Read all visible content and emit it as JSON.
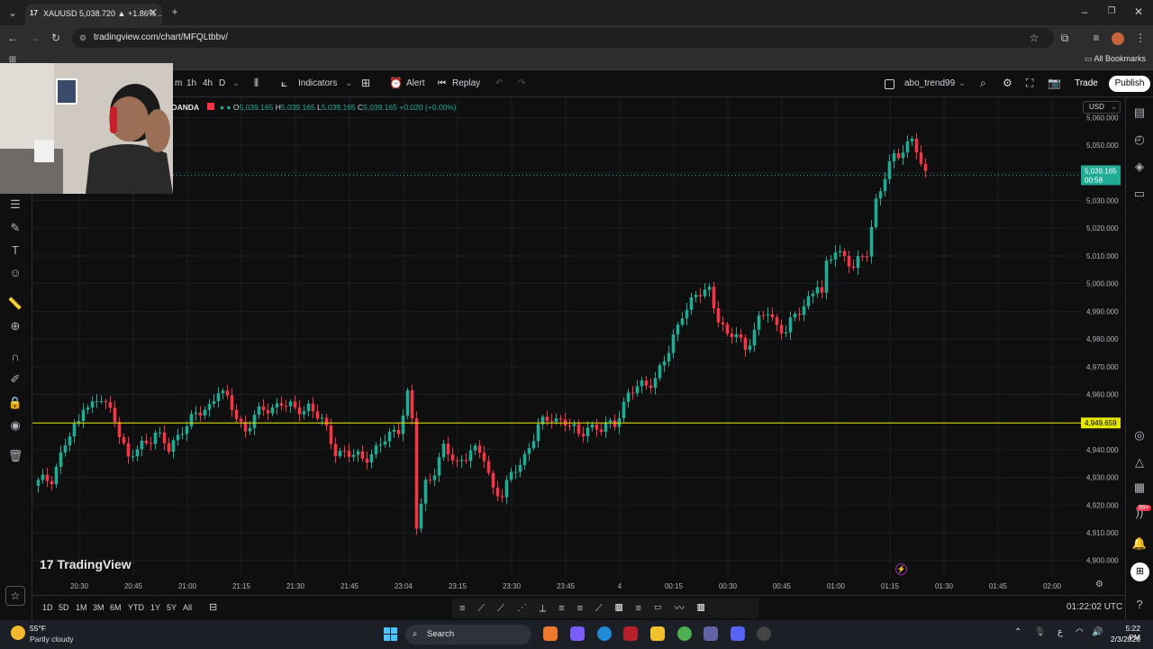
{
  "browser": {
    "tab_title": "XAUUSD 5,038.720 ▲ +1.86% ...",
    "url": "tradingview.com/chart/MFQLtbbv/",
    "bookmarks_label": "All Bookmarks"
  },
  "toolbar": {
    "intervals": [
      "m",
      "1h",
      "4h",
      "D"
    ],
    "indicators_label": "Indicators",
    "alert_label": "Alert",
    "replay_label": "Replay",
    "layout_name": "abo_trend99",
    "trade_label": "Trade",
    "publish_label": "Publish"
  },
  "legend": {
    "symbol": "OANDA",
    "open_label": "O",
    "open": "5,039.165",
    "high_label": "H",
    "high": "5,039.165",
    "low_label": "L",
    "low": "5,039.165",
    "close_label": "C",
    "close": "5,039.165",
    "change": "+0.020 (+0.00%)"
  },
  "currency": "USD",
  "watermark": "TradingView",
  "current_price": {
    "value": "5,039.165",
    "countdown": "00:58"
  },
  "horizontal_line": {
    "value": "4,949.659",
    "price": 4949.659,
    "color": "#e6e600"
  },
  "colors": {
    "up": "#22ab94",
    "down": "#f23645",
    "accent": "#2962ff"
  },
  "range_buttons": [
    "1D",
    "5D",
    "1M",
    "3M",
    "6M",
    "YTD",
    "1Y",
    "5Y",
    "All"
  ],
  "clock": "01:22:02 UTC",
  "taskbar": {
    "weather_temp": "55°F",
    "weather_desc": "Partly cloudy",
    "search_label": "Search",
    "time": "5:22 PM",
    "date": "2/3/2026",
    "notification_badge": "99+"
  },
  "chart_data": {
    "type": "candlestick",
    "symbol": "XAUUSD",
    "price_ticks": [
      "5,060.000",
      "5,050.000",
      "5,040.000",
      "5,030.000",
      "5,020.000",
      "5,010.000",
      "5,000.000",
      "4,990.000",
      "4,980.000",
      "4,970.000",
      "4,960.000",
      "4,950.000",
      "4,940.000",
      "4,930.000",
      "4,920.000",
      "4,910.000",
      "4,900.000"
    ],
    "price_tick_values": [
      5060,
      5050,
      5040,
      5030,
      5020,
      5010,
      5000,
      4990,
      4980,
      4970,
      4960,
      4950,
      4940,
      4930,
      4920,
      4910,
      4900
    ],
    "time_ticks": [
      "20:30",
      "20:45",
      "21:00",
      "21:15",
      "21:30",
      "21:45",
      "23:04",
      "23:15",
      "23:30",
      "23:45",
      "4",
      "00:15",
      "00:30",
      "00:45",
      "01:00",
      "01:15",
      "01:30",
      "01:45",
      "02:00"
    ],
    "ylim": [
      4896,
      5066
    ],
    "waypoints": [
      [
        0,
        4928
      ],
      [
        3,
        4930
      ],
      [
        6,
        4942
      ],
      [
        9,
        4950
      ],
      [
        10,
        4957
      ],
      [
        12,
        4956
      ],
      [
        14,
        4958
      ],
      [
        17,
        4952
      ],
      [
        20,
        4936
      ],
      [
        23,
        4942
      ],
      [
        26,
        4946
      ],
      [
        29,
        4940
      ],
      [
        32,
        4948
      ],
      [
        35,
        4952
      ],
      [
        38,
        4956
      ],
      [
        40,
        4962
      ],
      [
        43,
        4955
      ],
      [
        46,
        4947
      ],
      [
        48,
        4952
      ],
      [
        51,
        4955
      ],
      [
        54,
        4957
      ],
      [
        57,
        4954
      ],
      [
        60,
        4956
      ],
      [
        63,
        4950
      ],
      [
        66,
        4940
      ],
      [
        69,
        4938
      ],
      [
        72,
        4937
      ],
      [
        75,
        4940
      ],
      [
        78,
        4945
      ],
      [
        80,
        4948
      ],
      [
        82,
        4960
      ],
      [
        83,
        4950
      ],
      [
        84,
        4912
      ],
      [
        86,
        4928
      ],
      [
        88,
        4933
      ],
      [
        90,
        4940
      ],
      [
        93,
        4935
      ],
      [
        96,
        4940
      ],
      [
        99,
        4937
      ],
      [
        101,
        4926
      ],
      [
        103,
        4924
      ],
      [
        106,
        4933
      ],
      [
        108,
        4938
      ],
      [
        111,
        4948
      ],
      [
        114,
        4952
      ],
      [
        117,
        4950
      ],
      [
        120,
        4945
      ],
      [
        122,
        4949
      ],
      [
        125,
        4947
      ],
      [
        128,
        4950
      ],
      [
        131,
        4960
      ],
      [
        134,
        4963
      ],
      [
        137,
        4966
      ],
      [
        140,
        4975
      ],
      [
        143,
        4990
      ],
      [
        146,
        4995
      ],
      [
        149,
        4998
      ],
      [
        151,
        4988
      ],
      [
        153,
        4980
      ],
      [
        155,
        4982
      ],
      [
        157,
        4977
      ],
      [
        160,
        4986
      ],
      [
        162,
        4990
      ],
      [
        164,
        4985
      ],
      [
        166,
        4983
      ],
      [
        169,
        4990
      ],
      [
        171,
        4995
      ],
      [
        173,
        5000
      ],
      [
        174,
        4995
      ],
      [
        175,
        5006
      ],
      [
        177,
        5013
      ],
      [
        179,
        5010
      ],
      [
        181,
        5005
      ],
      [
        184,
        5012
      ],
      [
        186,
        5030
      ],
      [
        188,
        5038
      ],
      [
        190,
        5046
      ],
      [
        192,
        5049
      ],
      [
        194,
        5052
      ],
      [
        195,
        5048
      ],
      [
        196,
        5042
      ],
      [
        197,
        5039
      ]
    ],
    "candle_count": 198
  }
}
